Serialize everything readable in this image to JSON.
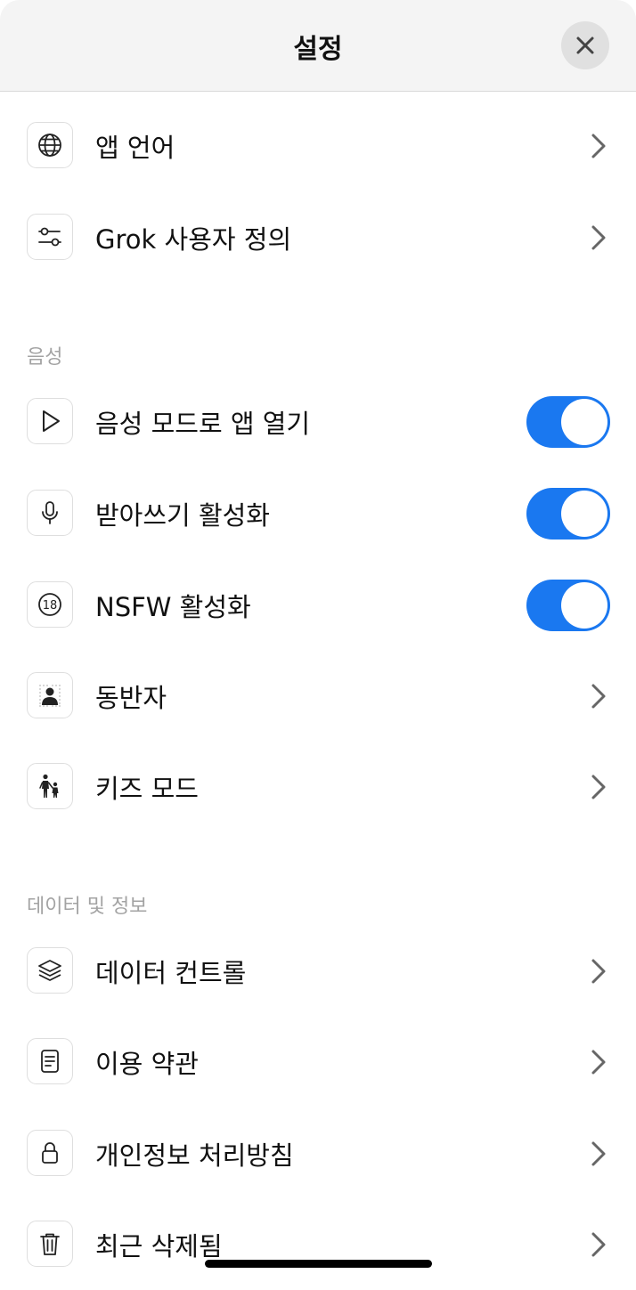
{
  "header": {
    "title": "설정",
    "close_icon": "close-icon"
  },
  "group_general": {
    "items": [
      {
        "label": "앱 언어",
        "icon": "globe-icon",
        "control": "chevron"
      },
      {
        "label": "Grok 사용자 정의",
        "icon": "sliders-icon",
        "control": "chevron"
      }
    ]
  },
  "group_voice": {
    "title": "음성",
    "items": [
      {
        "label": "음성 모드로 앱 열기",
        "icon": "play-icon",
        "control": "toggle",
        "on": true
      },
      {
        "label": "받아쓰기 활성화",
        "icon": "microphone-icon",
        "control": "toggle",
        "on": true
      },
      {
        "label": "NSFW 활성화",
        "icon": "age-18-icon",
        "control": "toggle",
        "on": true,
        "icon_text": "18"
      },
      {
        "label": "동반자",
        "icon": "companion-icon",
        "control": "chevron"
      },
      {
        "label": "키즈 모드",
        "icon": "family-icon",
        "control": "chevron"
      }
    ]
  },
  "group_data": {
    "title": "데이터 및 정보",
    "items": [
      {
        "label": "데이터 컨트롤",
        "icon": "layers-icon",
        "control": "chevron"
      },
      {
        "label": "이용 약관",
        "icon": "document-icon",
        "control": "chevron"
      },
      {
        "label": "개인정보 처리방침",
        "icon": "lock-icon",
        "control": "chevron"
      },
      {
        "label": "최근 삭제됨",
        "icon": "trash-icon",
        "control": "chevron"
      }
    ]
  },
  "colors": {
    "accent": "#1a78f0",
    "section_label": "#a3a3a3",
    "header_bg": "#f4f4f4"
  }
}
